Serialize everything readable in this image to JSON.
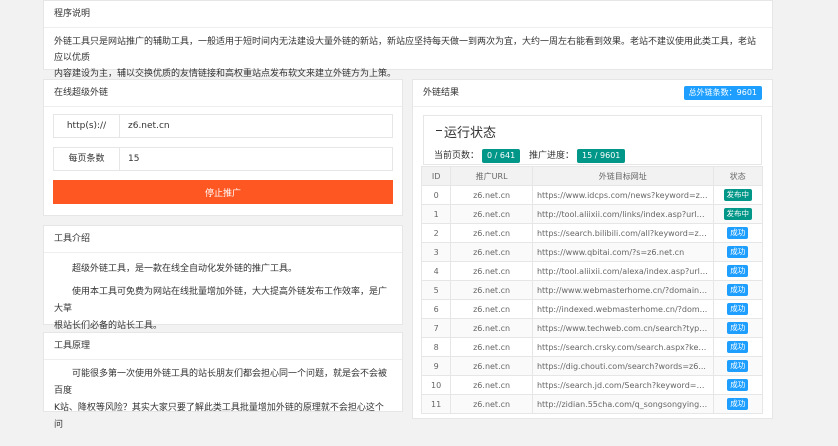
{
  "program": {
    "title": "程序说明",
    "line1": "外链工具只是网站推广的辅助工具，一般适用于短时间内无法建设大量外链的新站，新站应坚持每天做一到两次为宜，大约一周左右能看到效果。老站不建议使用此类工具，老站应以优质",
    "line2": "内容建设为主，辅以交换优质的友情链接和高权重站点发布软文来建立外链方为上策。"
  },
  "form": {
    "title": "在线超级外链",
    "url_label": "http(s)://",
    "url_value": "z6.net.cn",
    "per_page_label": "每页条数",
    "per_page_value": "15",
    "stop_label": "停止推广"
  },
  "intro": {
    "title": "工具介绍",
    "p1": "超级外链工具，是一款在线全自动化发外链的推广工具。",
    "p2_line1": "使用本工具可免费为网站在线批量增加外链，大大提高外链发布工作效率，是广大草",
    "p2_line2": "根站长们必备的站长工具。"
  },
  "principle": {
    "title": "工具原理",
    "line1": "可能很多第一次使用外链工具的站长朋友们都会担心同一个问题，就是会不会被百度",
    "line2": "K站、降权等风险？其实大家只要了解此类工具批量增加外链的原理就不会担心这个问"
  },
  "results": {
    "title": "外链结果",
    "total_badge": "总外链条数：9601",
    "status_title": "运行状态",
    "current_page_label": "当前页数：",
    "current_page_value": "0 / 641",
    "progress_label": "推广进度：",
    "progress_value": "15 / 9601",
    "columns": [
      "ID",
      "推广URL",
      "外链目标网址",
      "状态"
    ],
    "rows": [
      {
        "id": "0",
        "src": "z6.net.cn",
        "url": "https://www.idcps.com/news?keyword=z...",
        "status": "发布中",
        "kind": "pub"
      },
      {
        "id": "1",
        "src": "z6.net.cn",
        "url": "http://tool.aliixii.com/links/index.asp?url=...",
        "status": "发布中",
        "kind": "pub"
      },
      {
        "id": "2",
        "src": "z6.net.cn",
        "url": "https://search.bilibili.com/all?keyword=z6...",
        "status": "成功",
        "kind": "ok"
      },
      {
        "id": "3",
        "src": "z6.net.cn",
        "url": "https://www.qbitai.com/?s=z6.net.cn",
        "status": "成功",
        "kind": "ok"
      },
      {
        "id": "4",
        "src": "z6.net.cn",
        "url": "http://tool.aliixii.com/alexa/index.asp?url=...",
        "status": "成功",
        "kind": "ok"
      },
      {
        "id": "5",
        "src": "z6.net.cn",
        "url": "http://www.webmasterhome.cn/?domain=z6...",
        "status": "成功",
        "kind": "ok"
      },
      {
        "id": "6",
        "src": "z6.net.cn",
        "url": "http://indexed.webmasterhome.cn/?dom...",
        "status": "成功",
        "kind": "ok"
      },
      {
        "id": "7",
        "src": "z6.net.cn",
        "url": "https://www.techweb.com.cn/search?type...",
        "status": "成功",
        "kind": "ok"
      },
      {
        "id": "8",
        "src": "z6.net.cn",
        "url": "https://search.crsky.com/search.aspx?key...",
        "status": "成功",
        "kind": "ok"
      },
      {
        "id": "9",
        "src": "z6.net.cn",
        "url": "https://dig.chouti.com/search?words=z6...",
        "status": "成功",
        "kind": "ok"
      },
      {
        "id": "10",
        "src": "z6.net.cn",
        "url": "https://search.jd.com/Search?keyword=z6...",
        "status": "成功",
        "kind": "ok"
      },
      {
        "id": "11",
        "src": "z6.net.cn",
        "url": "http://zidian.55cha.com/q_songsongyingx...",
        "status": "成功",
        "kind": "ok"
      }
    ]
  },
  "colors": {
    "accent_orange": "#ff5722",
    "badge_blue": "#1e9fff",
    "badge_green": "#009688"
  }
}
